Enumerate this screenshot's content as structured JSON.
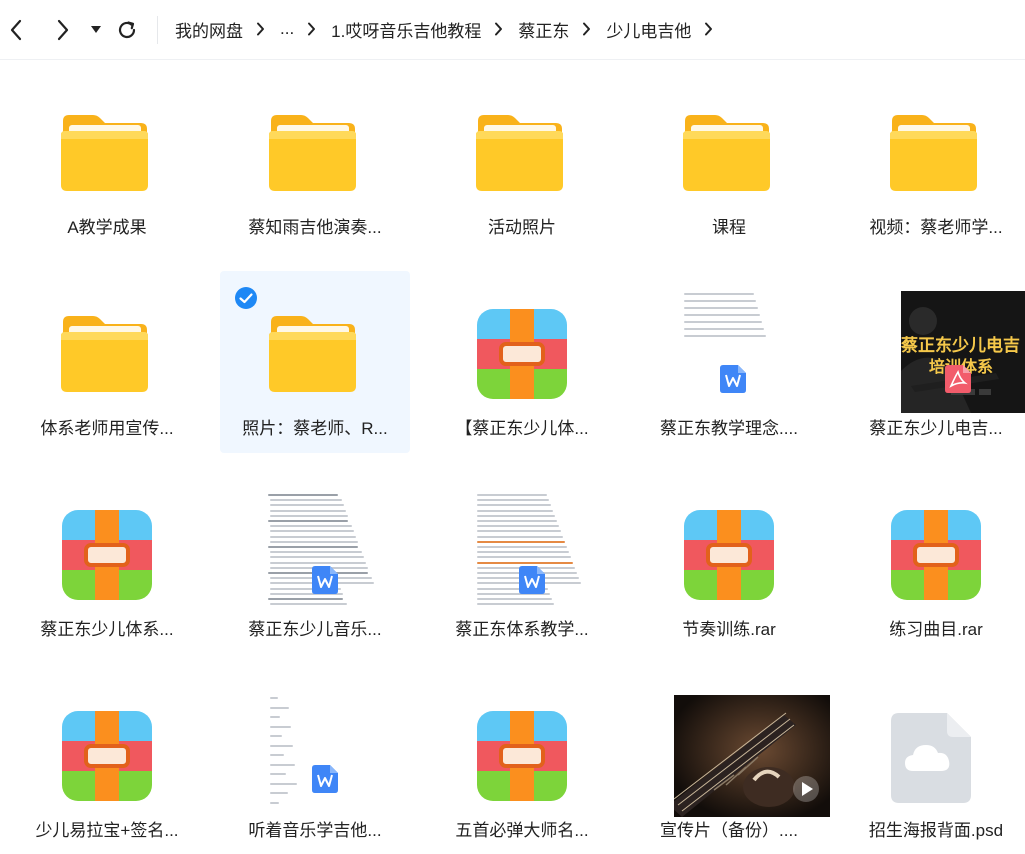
{
  "toolbar": {
    "back_icon": "chevron-left-icon",
    "forward_icon": "chevron-right-icon",
    "history_icon": "caret-down-icon",
    "refresh_icon": "refresh-icon"
  },
  "breadcrumb": [
    {
      "label": "我的网盘"
    },
    {
      "label": "..."
    },
    {
      "label": "1.哎呀音乐吉他教程"
    },
    {
      "label": "蔡正东"
    },
    {
      "label": "少儿电吉他"
    }
  ],
  "colors": {
    "accent": "#1e88f5",
    "folder": "#ffc832",
    "selected_bg": "#f0f7ff",
    "word_badge": "#3f86f7",
    "pdf_badge": "#f25c6b"
  },
  "files": [
    {
      "name": "A教学成果",
      "type": "folder"
    },
    {
      "name": "蔡知雨吉他演奏...",
      "type": "folder"
    },
    {
      "name": "活动照片",
      "type": "folder"
    },
    {
      "name": "课程",
      "type": "folder"
    },
    {
      "name": "视频：蔡老师学...",
      "type": "folder"
    },
    {
      "name": "体系老师用宣传...",
      "type": "folder"
    },
    {
      "name": "照片：蔡老师、R...",
      "type": "folder",
      "selected": true
    },
    {
      "name": "【蔡正东少儿体...",
      "type": "rar"
    },
    {
      "name": "蔡正东教学理念....",
      "type": "doc",
      "variant": 1
    },
    {
      "name": "蔡正东少儿电吉...",
      "type": "pdf",
      "poster_title": [
        "蔡正东少儿电吉",
        "培训体系"
      ]
    },
    {
      "name": "蔡正东少儿体系...",
      "type": "rar"
    },
    {
      "name": "蔡正东少儿音乐...",
      "type": "doc",
      "variant": 2
    },
    {
      "name": "蔡正东体系教学...",
      "type": "doc",
      "variant": 3
    },
    {
      "name": "节奏训练.rar",
      "type": "rar"
    },
    {
      "name": "练习曲目.rar",
      "type": "rar"
    },
    {
      "name": "少儿易拉宝+签名...",
      "type": "rar"
    },
    {
      "name": "听着音乐学吉他...",
      "type": "doc",
      "variant": 4
    },
    {
      "name": "五首必弹大师名...",
      "type": "rar"
    },
    {
      "name": "宣传片（备份）....",
      "type": "video"
    },
    {
      "name": "招生海报背面.psd",
      "type": "psd"
    }
  ]
}
